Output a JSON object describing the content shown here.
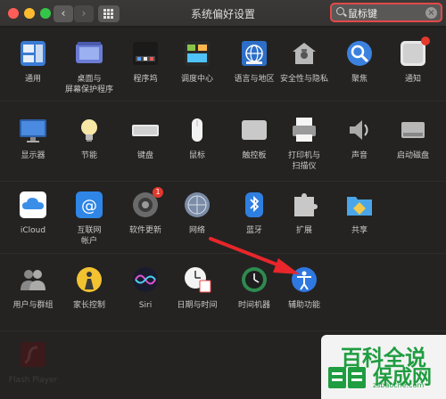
{
  "window": {
    "title": "系统偏好设置"
  },
  "search": {
    "query": "鼠标键",
    "clear_glyph": "×"
  },
  "nav": {
    "back": "‹",
    "forward": "›"
  },
  "rows": [
    [
      {
        "id": "general",
        "label": "通用"
      },
      {
        "id": "desktop",
        "label": "桌面与\n屏幕保护程序"
      },
      {
        "id": "dock",
        "label": "程序坞"
      },
      {
        "id": "mission",
        "label": "调度中心"
      },
      {
        "id": "language",
        "label": "语言与地区"
      },
      {
        "id": "security",
        "label": "安全性与隐私"
      },
      {
        "id": "spotlight",
        "label": "聚焦"
      },
      {
        "id": "notifications",
        "label": "通知"
      }
    ],
    [
      {
        "id": "displays",
        "label": "显示器"
      },
      {
        "id": "energy",
        "label": "节能"
      },
      {
        "id": "keyboard",
        "label": "键盘"
      },
      {
        "id": "mouse",
        "label": "鼠标"
      },
      {
        "id": "trackpad",
        "label": "触控板"
      },
      {
        "id": "printers",
        "label": "打印机与\n扫描仪"
      },
      {
        "id": "sound",
        "label": "声音"
      },
      {
        "id": "startup",
        "label": "启动磁盘"
      }
    ],
    [
      {
        "id": "icloud",
        "label": "iCloud"
      },
      {
        "id": "internet",
        "label": "互联网\n帐户"
      },
      {
        "id": "update",
        "label": "软件更新",
        "badge": "1"
      },
      {
        "id": "network",
        "label": "网络"
      },
      {
        "id": "bluetooth",
        "label": "蓝牙"
      },
      {
        "id": "extensions",
        "label": "扩展"
      },
      {
        "id": "sharing",
        "label": "共享"
      }
    ],
    [
      {
        "id": "users",
        "label": "用户与群组"
      },
      {
        "id": "parental",
        "label": "家长控制"
      },
      {
        "id": "siri",
        "label": "Siri"
      },
      {
        "id": "datetime",
        "label": "日期与时间"
      },
      {
        "id": "timemachine",
        "label": "时间机器"
      },
      {
        "id": "accessibility",
        "label": "辅助功能"
      }
    ],
    [
      {
        "id": "flash",
        "label": "Flash Player"
      }
    ]
  ],
  "watermark": {
    "title": "百科全说",
    "cn": "保成网",
    "url": "zsbaoche.com"
  },
  "colors": {
    "highlight_arrow": "#e8262b",
    "search_border": "#e24a4a",
    "watermark_green": "#1f9d40"
  }
}
